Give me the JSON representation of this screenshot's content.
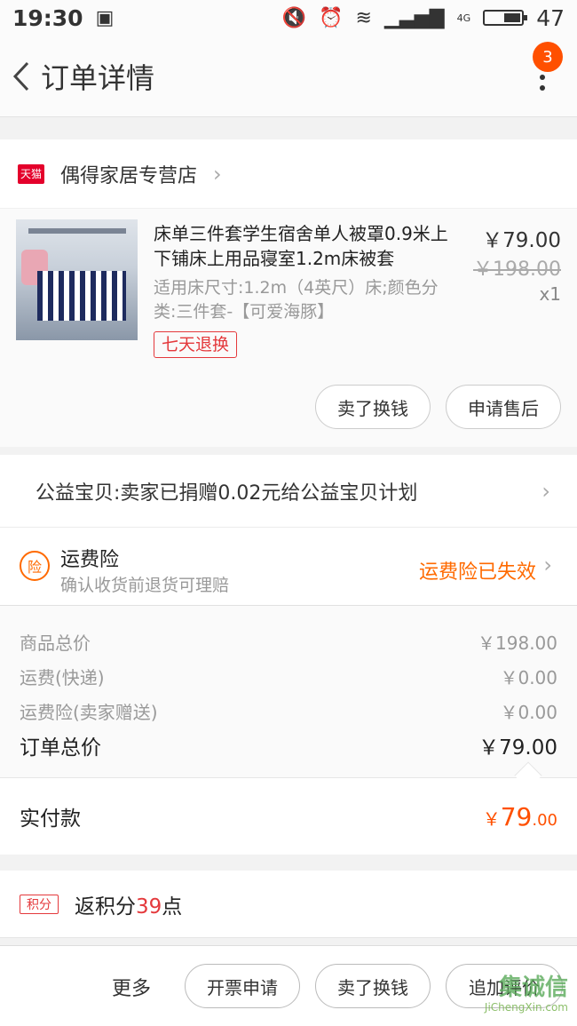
{
  "statusbar": {
    "time": "19:30",
    "battery": "47",
    "battery_level": 0.47,
    "signal_label": "4G"
  },
  "navbar": {
    "title": "订单详情",
    "badge_count": "3"
  },
  "shop": {
    "platform_tag": "天猫",
    "name": "偶得家居专营店"
  },
  "item": {
    "title": "床单三件套学生宿舍单人被罩0.9米上下铺床上用品寝室1.2m床被套",
    "spec": "适用床尺寸:1.2m（4英尺）床;颜色分类:三件套-【可爱海豚】",
    "return_tag": "七天退换",
    "price": "￥79.00",
    "original_price": "￥198.00",
    "quantity": "x1",
    "sell_button": "卖了换钱",
    "after_sale_button": "申请售后"
  },
  "charity": {
    "text": "公益宝贝:卖家已捐赠0.02元给公益宝贝计划"
  },
  "shipping_insurance": {
    "icon_label": "险",
    "title": "运费险",
    "subtitle": "确认收货前退货可理赔",
    "status": "运费险已失效"
  },
  "summary": {
    "lines": [
      {
        "label": "商品总价",
        "value": "￥198.00"
      },
      {
        "label": "运费(快递)",
        "value": "￥0.00"
      },
      {
        "label": "运费险(卖家赠送)",
        "value": "￥0.00"
      }
    ],
    "total_label": "订单总价",
    "total_value": "￥79.00"
  },
  "paid": {
    "label": "实付款",
    "currency": "￥",
    "integer": "79",
    "decimal": ".00"
  },
  "points": {
    "tag": "积分",
    "prefix": "返积分",
    "number": "39",
    "suffix": "点"
  },
  "bottombar": {
    "more": "更多",
    "invoice": "开票申请",
    "sell": "卖了换钱",
    "review": "追加评价"
  },
  "watermark": {
    "big": "集诚信",
    "small": "JiChengXin.com"
  },
  "colors": {
    "accent": "#ff5000",
    "tmall_red": "#e4002b",
    "tag_red": "#e4393c"
  }
}
